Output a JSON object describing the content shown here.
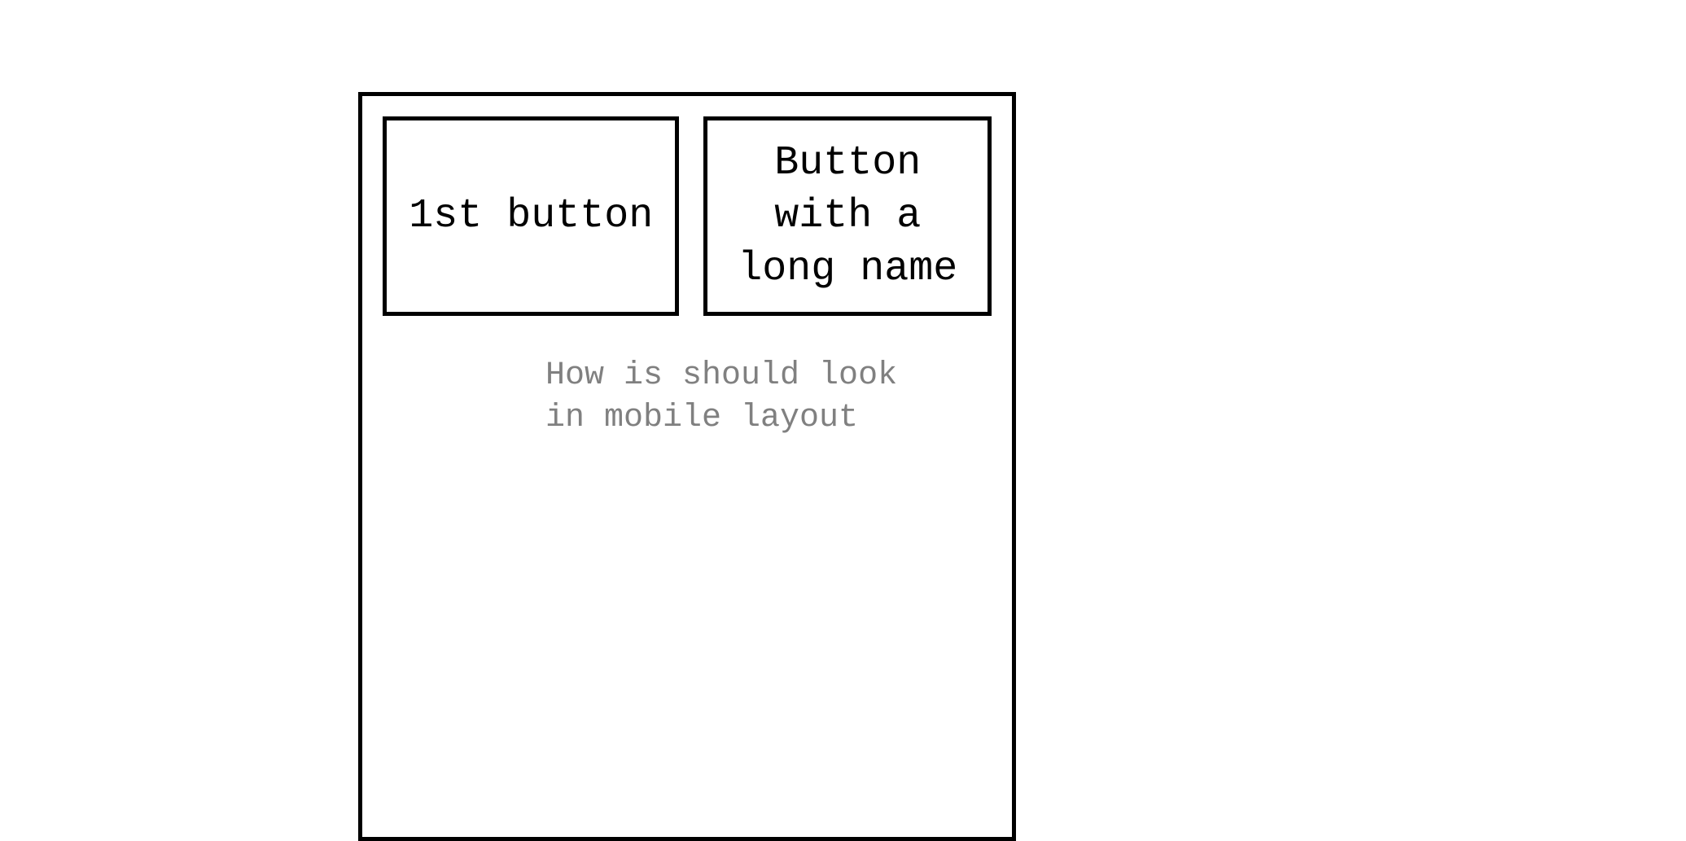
{
  "buttons": {
    "first": "1st button",
    "second": "Button with a long name"
  },
  "caption": "How is should look\nin mobile layout"
}
